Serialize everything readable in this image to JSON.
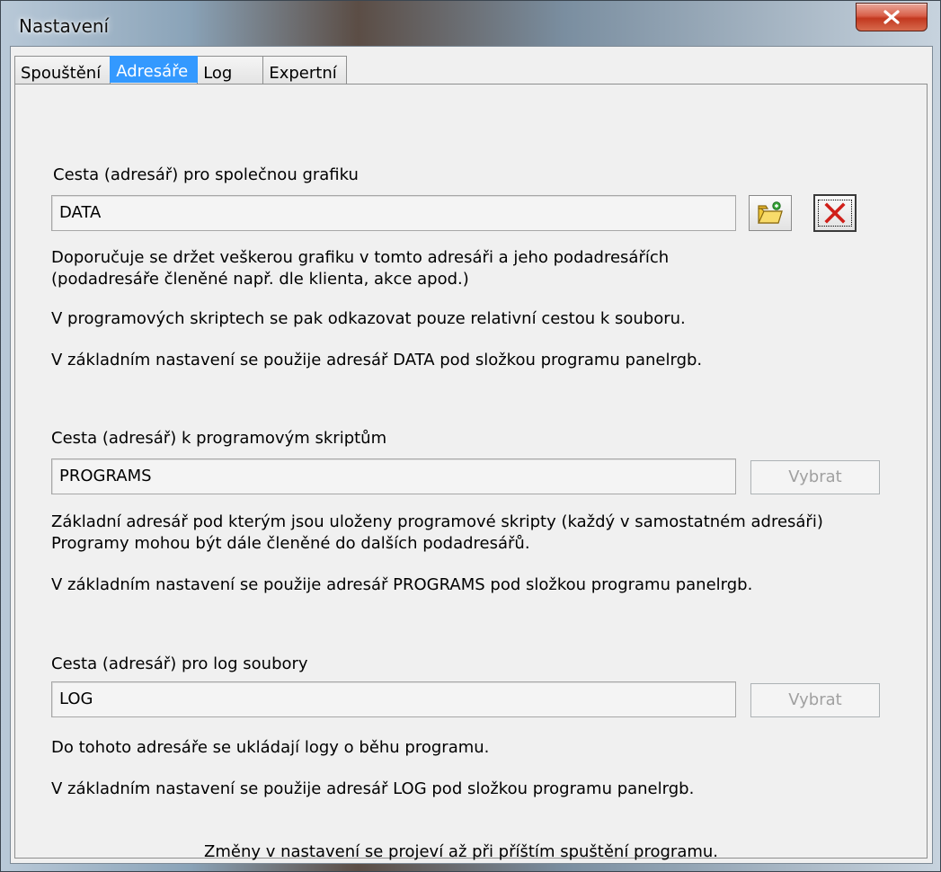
{
  "window": {
    "title": "Nastavení"
  },
  "tabs": [
    {
      "label": "Spouštění",
      "active": false
    },
    {
      "label": "Adresáře",
      "active": true
    },
    {
      "label": "Log",
      "active": false
    },
    {
      "label": "Expertní",
      "active": false
    }
  ],
  "graphics": {
    "label": "Cesta (adresář) pro společnou grafiku",
    "value": "DATA",
    "desc1": "Doporučuje se držet veškerou grafiku v tomto adresáři a jeho podadresářích",
    "desc2": "(podadresáře členěné např. dle klienta, akce apod.)",
    "desc3": "V programových skriptech se pak odkazovat pouze relativní cestou k souboru.",
    "desc4": "V základním nastavení se použije adresář DATA pod složkou programu panelrgb."
  },
  "scripts": {
    "label": "Cesta (adresář) k programovým skriptům",
    "value": "PROGRAMS",
    "button": "Vybrat",
    "desc1": "Základní adresář pod kterým jsou uloženy programové skripty (každý v samostatném adresáři)",
    "desc2": "Programy mohou být dále členěné do dalších podadresářů.",
    "desc3": "V základním nastavení se použije adresář PROGRAMS pod složkou programu panelrgb."
  },
  "logs": {
    "label": "Cesta (adresář) pro log soubory",
    "value": "LOG",
    "button": "Vybrat",
    "desc1": "Do tohoto adresáře se ukládají logy o běhu programu.",
    "desc2": "V základním nastavení se použije adresář LOG pod složkou programu panelrgb."
  },
  "footer": "Změny v nastavení se projeví až při příštím spuštění programu.",
  "colors": {
    "active_tab": "#3399ff",
    "close_button": "#c2381f",
    "clear_icon": "#d0201a"
  },
  "icons": [
    "close-icon",
    "folder-open-icon",
    "clear-x-icon"
  ]
}
